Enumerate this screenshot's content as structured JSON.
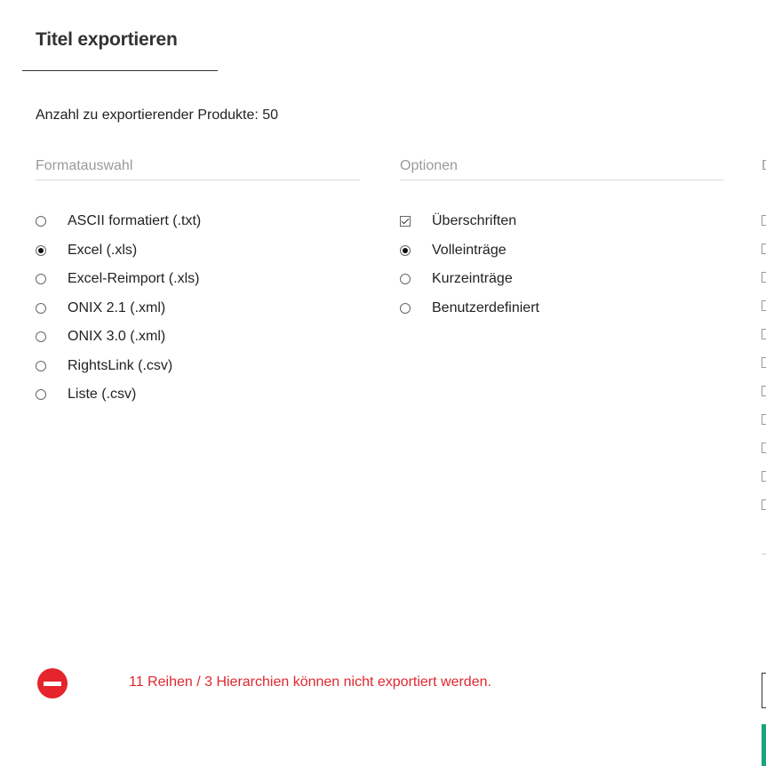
{
  "dialog": {
    "title": "Titel exportieren",
    "product_count_label": "Anzahl zu exportierender Produkte: 50"
  },
  "format": {
    "heading": "Formatauswahl",
    "options": [
      {
        "label": "ASCII formatiert (.txt)",
        "checked": false
      },
      {
        "label": "Excel (.xls)",
        "checked": true
      },
      {
        "label": "Excel-Reimport (.xls)",
        "checked": false
      },
      {
        "label": "ONIX 2.1 (.xml)",
        "checked": false
      },
      {
        "label": "ONIX 3.0 (.xml)",
        "checked": false
      },
      {
        "label": "RightsLink (.csv)",
        "checked": false
      },
      {
        "label": "Liste (.csv)",
        "checked": false
      }
    ]
  },
  "options": {
    "heading": "Optionen",
    "headers_checkbox": {
      "label": "Überschriften",
      "checked": true
    },
    "entry_types": [
      {
        "label": "Volleinträge",
        "checked": true
      },
      {
        "label": "Kurzeinträge",
        "checked": false
      },
      {
        "label": "Benutzerdefiniert",
        "checked": false
      }
    ]
  },
  "third_column": {
    "heading_fragment": "D",
    "checkbox_count": 11
  },
  "error": {
    "icon": "no-entry-icon",
    "message": "11 Reihen / 3 Hierarchien können nicht exportiert werden.",
    "color": "#e0272f"
  },
  "colors": {
    "accent_green": "#1aa37c",
    "error_red": "#e5242c"
  }
}
